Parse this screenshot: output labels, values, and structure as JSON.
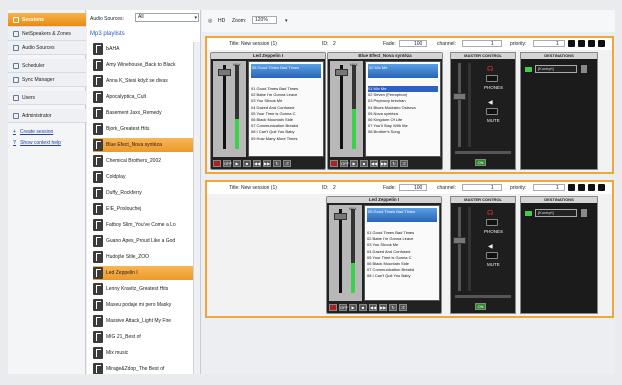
{
  "nav": {
    "items": [
      {
        "label": "Sessions",
        "icon": "sessions-icon"
      },
      {
        "label": "NetSpeakers & Zones",
        "icon": "speakers-icon"
      },
      {
        "label": "Audio Sources",
        "icon": "audio-sources-icon"
      },
      {
        "label": "Scheduler",
        "icon": "scheduler-icon"
      },
      {
        "label": "Sync Manager",
        "icon": "sync-icon"
      },
      {
        "label": "Users",
        "icon": "users-icon"
      },
      {
        "label": "Administrator",
        "icon": "admin-icon"
      }
    ],
    "links": [
      "Create session",
      "Show context help"
    ]
  },
  "sources": {
    "label": "Audio Sources:",
    "select_value": "All",
    "title": "Mp3 playlists",
    "items": [
      "ЬАНА",
      "Amy Winehouse_Back to Black",
      "Anna K_Stesi když se divas",
      "Apocalyptica_Cult",
      "Basement Jaxx_Remedy",
      "Bjork_Greatest Hits",
      "Blue Efect_Nova syntéza",
      "Chemical Brothers_2002",
      "Coldplay",
      "Duffy_Rockferry",
      "E!E_Poslouchej",
      "Fatboy Slim_You've Come a Lo",
      "Guano Apes_Proud Like a God",
      "Hudojše Stile_ZOO",
      "Led Zeppelin I",
      "Lenny Kravitz_Greatest Hits",
      "Maxeu podaje mi pero Masky",
      "Massive Attack_Light My Fire",
      "MIG 21_Best of",
      "Mix music",
      "Mirage&Zdop_The Best of"
    ],
    "selected": [
      "Blue Efect_Nova syntéza",
      "Led Zeppelin I"
    ]
  },
  "toolbar": {
    "label": "Zoom:",
    "zoom": "120%",
    "pre": "HD"
  },
  "sessions": [
    {
      "title": "Title: New session (1)",
      "id_label": "ID:",
      "id": "2",
      "fade_label": "Fade:",
      "fade": "100",
      "channel_label": "channel:",
      "channel": "1",
      "priority_label": "priority:",
      "priority": "1",
      "decks": [
        {
          "name": "Led Zeppelin I",
          "now": "05 Good Times Bad Times",
          "tracks": [
            "01 Good Times Bad Times",
            "02 Babe I'm Gonna Leave",
            "03 You Shook Me",
            "04 Dazed And Confused",
            "05 Your Time is Gonna C",
            "06 Black Mountain Side",
            "07 Communication Breakd",
            "08 I Can't Quit You Baby",
            "09 How Many More Times"
          ],
          "highlight": -1
        },
        {
          "name": "Blue Efect_Nova syntéza",
          "now": "02 Mix Me",
          "tracks": [
            "01 Mix Me",
            "02 Seven (Ferrophon)",
            "03 Pepinovy brechan",
            "04 Blues Modraho Ostrova",
            "05 Nova syntéza",
            "06 Kingdom Of Life",
            "07 You'll Stay With Me",
            "08 Brother's Song"
          ],
          "highlight": 0
        }
      ],
      "master": {
        "title": "MASTER CONTROL",
        "phones": "PHONES",
        "mute": "MUTE"
      },
      "dest": {
        "title": "DESTINATIONS",
        "entry": "[Kuchyň]"
      }
    },
    {
      "title": "Title: New session (1)",
      "id_label": "ID:",
      "id": "2",
      "fade_label": "Fade:",
      "fade": "100",
      "channel_label": "channel:",
      "channel": "1",
      "priority_label": "priority:",
      "priority": "1",
      "decks": [
        {
          "name": "Led Zeppelin I",
          "now": "05 Good Times Bad Times",
          "tracks": [
            "01 Good Times Bad Times",
            "02 Babe I'm Gonna Leave",
            "03 You Shook Me",
            "04 Dazed And Confused",
            "05 Your Time is Gonna C",
            "06 Black Mountain Side",
            "07 Communication Breakd",
            "08 I Can't Quit You Baby"
          ],
          "highlight": -1
        }
      ],
      "master": {
        "title": "MASTER CONTROL",
        "phones": "PHONES",
        "mute": "MUTE"
      },
      "dest": {
        "title": "DESTINATIONS",
        "entry": "[Kuchyň]"
      }
    }
  ],
  "deck_labels": {
    "max": "MAX",
    "on": "ON",
    "off": "OFF"
  },
  "colors": {
    "accent": "#f0a63a",
    "selection": "#2d62c4",
    "meter": "#3bd14a"
  }
}
